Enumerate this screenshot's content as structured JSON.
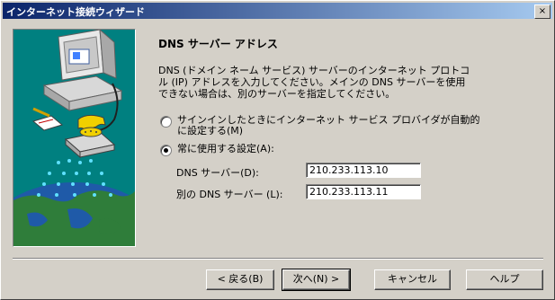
{
  "window": {
    "title": "インターネット接続ウィザード",
    "close_glyph": "×"
  },
  "page": {
    "heading": "DNS サーバー アドレス",
    "description": "DNS (ドメイン ネーム サービス) サーバーのインターネット プロトコル (IP) アドレスを入力してください。メインの DNS サーバーを使用できない場合は、別のサーバーを指定してください。"
  },
  "options": {
    "auto_line1": "サインインしたときにインターネット サービス プロバイダが自動的",
    "auto_line2": "に設定する(M)",
    "manual_label": "常に使用する設定(A):",
    "selected": "manual"
  },
  "fields": {
    "dns_label": "DNS サーバー(D):",
    "dns_value": "210.233.113.10",
    "alt_dns_label": "別の DNS サーバー (L):",
    "alt_dns_value": "210.233.113.11"
  },
  "buttons": {
    "back": "< 戻る(B)",
    "next": "次へ(N) >",
    "cancel": "キャンセル",
    "help": "ヘルプ"
  },
  "colors": {
    "titlebar_start": "#0a246a",
    "titlebar_end": "#a6caf0",
    "dialog": "#d4d0c8",
    "illustration_bg": "#008080"
  },
  "icons": [
    "computer-illustration",
    "telephone-illustration",
    "globe-illustration",
    "radio-button",
    "close-icon"
  ]
}
